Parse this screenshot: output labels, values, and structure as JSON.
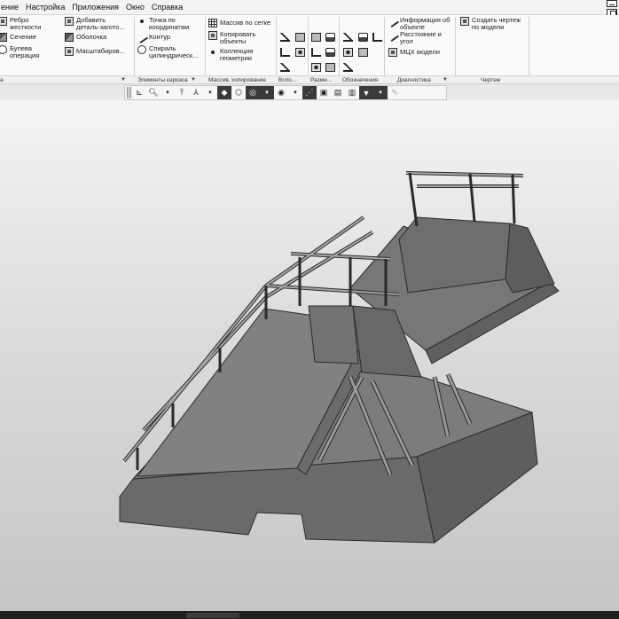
{
  "menu": [
    "ение",
    "Настройка",
    "Приложения",
    "Окно",
    "Справка"
  ],
  "ribbon": {
    "buttons": {
      "rib": "Ребро\nжесткости",
      "section": "Сечение",
      "boolean": "Булева\nоперация",
      "add_part": "Добавить\nдеталь-загото...",
      "shell": "Оболочка",
      "scale": "Масштабиров...",
      "point_coords": "Точка по\nкоординатам",
      "contour": "Контур",
      "spiral": "Спираль\nцилиндрическ...",
      "array_grid": "Массив по сетке",
      "copy_objects": "Копировать\nобъекты",
      "geometry_collection": "Коллекция\nгеометрии",
      "object_info": "Информация об\nобъекте",
      "distance_angle": "Расстояние и\nугол",
      "mass_props": "МЦХ модели",
      "create_drawing": "Создать чертеж\nпо модели"
    },
    "groups": [
      "а",
      "Элементы каркаса",
      "Массив, копирование",
      "Вспо...",
      "Разме...",
      "Обозначения",
      "Диагностика",
      "Чертеж"
    ]
  },
  "colors": {
    "ribbon_bg": "#fafafa",
    "viewport_top": "#f4f4f4",
    "viewport_bottom": "#c5c5c5",
    "model_face_top": "#7a7a7a",
    "model_face_side": "#6a6a6a",
    "model_edge": "#2b2b2b"
  },
  "viewbar_icons": [
    "grip",
    "axes-icon",
    "zoom-icon",
    "dropdown",
    "orient-icon",
    "dropdown",
    "view-icon",
    "dropdown",
    "shaded-icon",
    "wireframe-icon",
    "hide-icon",
    "dropdown",
    "visibility-icon",
    "dropdown",
    "section-icon",
    "filter-icon",
    "dropdown",
    "pencil-icon"
  ]
}
